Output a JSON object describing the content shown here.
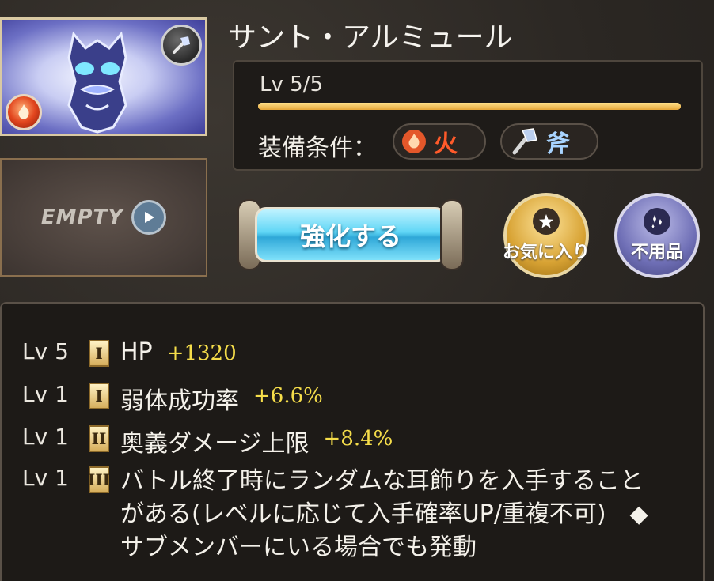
{
  "item": {
    "name": "サント・アルミュール",
    "level": "Lv 5/5",
    "level_progress": 1.0,
    "equip_condition_label": "装備条件：",
    "conditions": [
      {
        "label": "火",
        "icon": "fire-icon",
        "color": "#ff5a2a"
      },
      {
        "label": "斧",
        "icon": "axe-icon",
        "color": "#a8d4ff"
      }
    ]
  },
  "slot": {
    "empty_label": "EMPTY"
  },
  "buttons": {
    "upgrade": "強化する",
    "favorite": "お気に入り",
    "unused": "不用品"
  },
  "skills": [
    {
      "level": "Lv 5",
      "rank": "I",
      "name": "HP",
      "value": "+1320"
    },
    {
      "level": "Lv 1",
      "rank": "I",
      "name": "弱体成功率",
      "value": "+6.6%"
    },
    {
      "level": "Lv 1",
      "rank": "II",
      "name": "奥義ダメージ上限",
      "value": "+8.4%"
    },
    {
      "level": "Lv 1",
      "rank": "III",
      "name": "バトル終了時にランダムな耳飾りを入手することがある(レベルに応じて入手確率UP/重複不可)　◆サブメンバーにいる場合でも発動",
      "value": ""
    }
  ],
  "colors": {
    "value_text": "#f5dd4a",
    "upgrade_button": "#4fc3ea",
    "favorite_button": "#d8a334",
    "unused_button": "#6f6fb6"
  }
}
